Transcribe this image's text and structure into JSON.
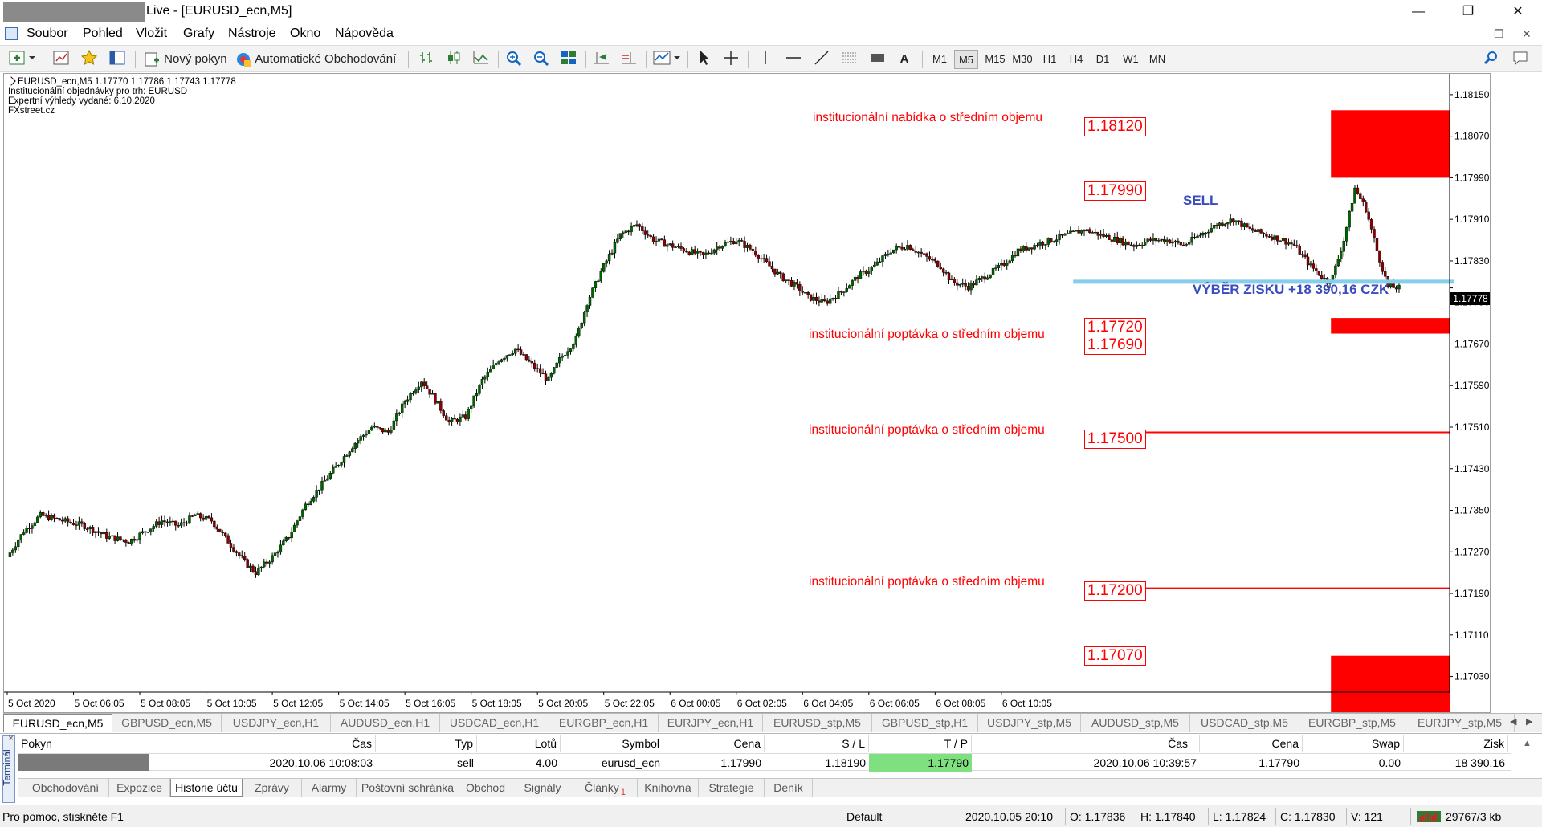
{
  "window": {
    "title": "Live - [EURUSD_ecn,M5]",
    "minimize": "—",
    "restore": "❐",
    "close": "✕",
    "inner_min": "—",
    "inner_restore": "❐",
    "inner_close": "✕"
  },
  "menu": {
    "items": [
      "Soubor",
      "Pohled",
      "Vložit",
      "Grafy",
      "Nástroje",
      "Okno",
      "Nápověda"
    ]
  },
  "toolbar": {
    "new_order": "Nový pokyn",
    "auto_trading": "Automatické Obchodování",
    "text_tool": "A",
    "timeframes": [
      "M1",
      "M5",
      "M15",
      "M30",
      "H1",
      "H4",
      "D1",
      "W1",
      "MN"
    ],
    "active_timeframe": "M5"
  },
  "chart": {
    "header_lines": [
      "EURUSD_ecn,M5  1.17770 1.17786 1.17743 1.17778",
      "Institucionální objednávky pro trh: EURUSD",
      "Expertní výhledy vydané: 6.10.2020",
      "FXstreet.cz"
    ],
    "current_price": "1.17778",
    "zone_labels": {
      "supply": "institucionální nabídka o středním objemu",
      "demand1": "institucionální poptávka o středním objemu",
      "demand2": "institucionální poptávka o středním objemu",
      "demand3": "institucionální poptávka o středním objemu"
    },
    "levels": {
      "l1": "1.18120",
      "l2": "1.17990",
      "l3": "1.17720",
      "l4": "1.17690",
      "l5": "1.17500",
      "l6": "1.17200",
      "l7": "1.17070"
    },
    "sell_label": "SELL",
    "profit_label": "VÝBĚR ZISKU +18 390,16 CZK",
    "colors": {
      "zone": "#ff0000",
      "tp_line": "#87ceeb",
      "annotation": "#3b4cc0",
      "bull": "#006400",
      "bear": "#8b0000"
    }
  },
  "chart_data": {
    "type": "candlestick",
    "ylim": [
      1.17,
      1.1819
    ],
    "price_ticks": [
      "1.18150",
      "1.18070",
      "1.17990",
      "1.17910",
      "1.17830",
      "1.17750",
      "1.17670",
      "1.17590",
      "1.17510",
      "1.17430",
      "1.17350",
      "1.17270",
      "1.17190",
      "1.17110",
      "1.17030"
    ],
    "time_ticks": [
      "5 Oct 2020",
      "5 Oct 06:05",
      "5 Oct 08:05",
      "5 Oct 10:05",
      "5 Oct 12:05",
      "5 Oct 14:05",
      "5 Oct 16:05",
      "5 Oct 18:05",
      "5 Oct 20:05",
      "5 Oct 22:05",
      "6 Oct 00:05",
      "6 Oct 02:05",
      "6 Oct 04:05",
      "6 Oct 06:05",
      "6 Oct 08:05",
      "6 Oct 10:05"
    ],
    "close_path": [
      [
        0,
        1.1726
      ],
      [
        6,
        1.1731
      ],
      [
        12,
        1.1734
      ],
      [
        20,
        1.1733
      ],
      [
        28,
        1.1732
      ],
      [
        36,
        1.173
      ],
      [
        44,
        1.1729
      ],
      [
        50,
        1.1731
      ],
      [
        56,
        1.1733
      ],
      [
        62,
        1.1732
      ],
      [
        68,
        1.1734
      ],
      [
        74,
        1.1733
      ],
      [
        80,
        1.1729
      ],
      [
        86,
        1.1725
      ],
      [
        90,
        1.1723
      ],
      [
        96,
        1.1726
      ],
      [
        102,
        1.173
      ],
      [
        108,
        1.1736
      ],
      [
        114,
        1.174
      ],
      [
        120,
        1.1744
      ],
      [
        126,
        1.1748
      ],
      [
        132,
        1.1751
      ],
      [
        138,
        1.175
      ],
      [
        144,
        1.1756
      ],
      [
        150,
        1.176
      ],
      [
        154,
        1.1757
      ],
      [
        160,
        1.1752
      ],
      [
        166,
        1.1753
      ],
      [
        172,
        1.176
      ],
      [
        178,
        1.1764
      ],
      [
        184,
        1.1766
      ],
      [
        190,
        1.1763
      ],
      [
        196,
        1.176
      ],
      [
        200,
        1.1764
      ],
      [
        206,
        1.1768
      ],
      [
        210,
        1.1775
      ],
      [
        216,
        1.1782
      ],
      [
        222,
        1.1788
      ],
      [
        228,
        1.179
      ],
      [
        234,
        1.1787
      ],
      [
        240,
        1.1786
      ],
      [
        246,
        1.1785
      ],
      [
        252,
        1.1784
      ],
      [
        258,
        1.1786
      ],
      [
        264,
        1.1787
      ],
      [
        270,
        1.1785
      ],
      [
        276,
        1.1782
      ],
      [
        280,
        1.178
      ],
      [
        286,
        1.1778
      ],
      [
        290,
        1.1776
      ],
      [
        296,
        1.1775
      ],
      [
        302,
        1.1777
      ],
      [
        308,
        1.178
      ],
      [
        314,
        1.1782
      ],
      [
        320,
        1.1785
      ],
      [
        326,
        1.1786
      ],
      [
        332,
        1.1784
      ],
      [
        338,
        1.1782
      ],
      [
        342,
        1.1779
      ],
      [
        348,
        1.1778
      ],
      [
        354,
        1.178
      ],
      [
        360,
        1.1782
      ],
      [
        366,
        1.1785
      ],
      [
        372,
        1.1786
      ],
      [
        378,
        1.1787
      ],
      [
        384,
        1.1788
      ],
      [
        390,
        1.1789
      ],
      [
        396,
        1.1788
      ],
      [
        402,
        1.1787
      ],
      [
        408,
        1.1786
      ],
      [
        414,
        1.1787
      ],
      [
        420,
        1.1787
      ],
      [
        426,
        1.1786
      ],
      [
        432,
        1.1788
      ],
      [
        438,
        1.179
      ],
      [
        444,
        1.1791
      ],
      [
        450,
        1.1789
      ],
      [
        456,
        1.1788
      ],
      [
        462,
        1.1787
      ],
      [
        466,
        1.1786
      ],
      [
        472,
        1.1782
      ],
      [
        478,
        1.1779
      ],
      [
        480,
        1.178
      ],
      [
        484,
        1.1787
      ],
      [
        488,
        1.1797
      ],
      [
        492,
        1.1793
      ],
      [
        496,
        1.1785
      ],
      [
        500,
        1.1778
      ],
      [
        504,
        1.17778
      ]
    ]
  },
  "symbol_tabs": [
    "EURUSD_ecn,M5",
    "GBPUSD_ecn,M5",
    "USDJPY_ecn,H1",
    "AUDUSD_ecn,H1",
    "USDCAD_ecn,H1",
    "EURGBP_ecn,H1",
    "EURJPY_ecn,H1",
    "EURUSD_stp,M5",
    "GBPUSD_stp,H1",
    "USDJPY_stp,M5",
    "AUDUSD_stp,M5",
    "USDCAD_stp,M5",
    "EURGBP_stp,M5",
    "EURJPY_stp,M5"
  ],
  "terminal": {
    "side_label": "Terminál",
    "headers": [
      "Pokyn",
      "Čas",
      "Typ",
      "Lotů",
      "Symbol",
      "Cena",
      "S / L",
      "T / P",
      "Čas",
      "Cena",
      "Swap",
      "Zisk"
    ],
    "row": {
      "time_open": "2020.10.06 10:08:03",
      "type": "sell",
      "lots": "4.00",
      "symbol": "eurusd_ecn",
      "price_open": "1.17990",
      "sl": "1.18190",
      "tp": "1.17790",
      "time_close": "2020.10.06 10:39:57",
      "price_close": "1.17790",
      "swap": "0.00",
      "profit": "18 390.16"
    },
    "tabs": [
      "Obchodování",
      "Expozice",
      "Historie účtu",
      "Zprávy",
      "Alarmy",
      "Poštovní schránka",
      "Obchod",
      "Signály",
      "Články",
      "Knihovna",
      "Strategie",
      "Deník"
    ],
    "active_tab": "Historie účtu",
    "articles_badge": "1"
  },
  "status": {
    "help": "Pro pomoc, stiskněte F1",
    "profile": "Default",
    "datetime": "2020.10.05 20:10",
    "open": "O: 1.17836",
    "high": "H: 1.17840",
    "low": "L: 1.17824",
    "close": "C: 1.17830",
    "volume": "V: 121",
    "traffic": "29767/3 kb"
  }
}
